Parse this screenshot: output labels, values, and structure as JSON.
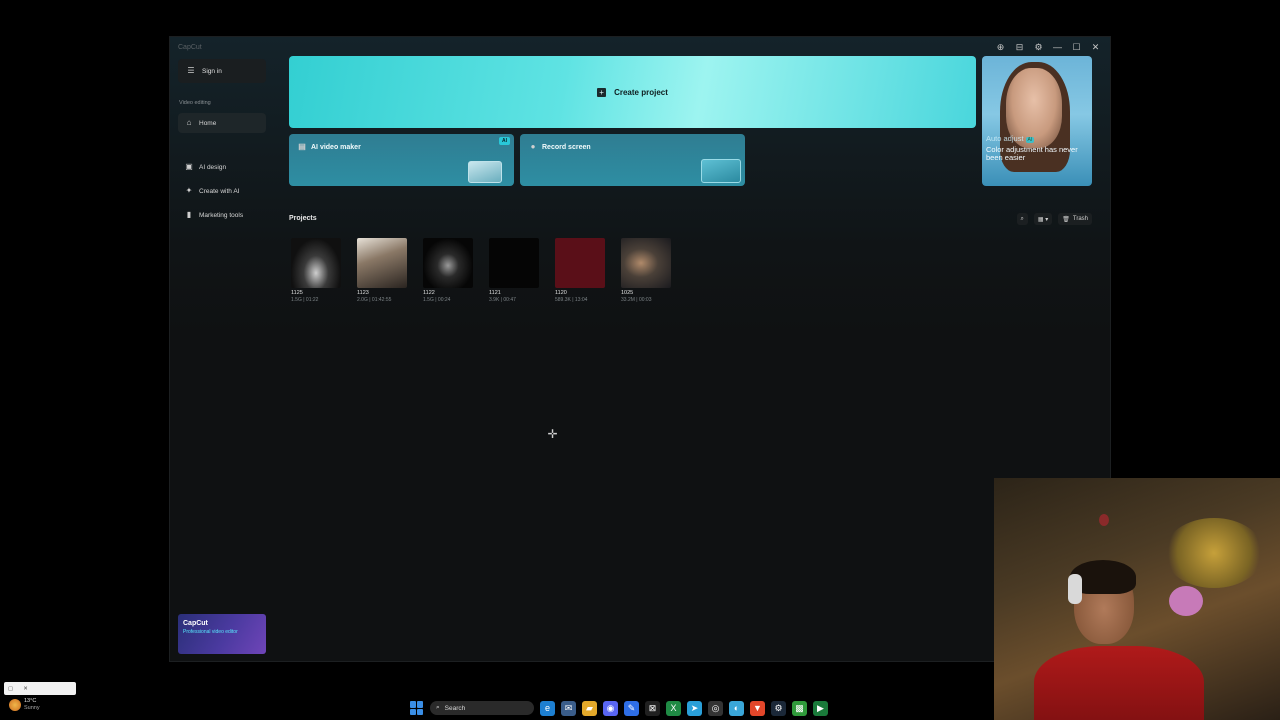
{
  "window": {
    "title": "CapCut",
    "controls": [
      "⊕",
      "⊟",
      "⚙",
      "—",
      "☐",
      "✕"
    ]
  },
  "sidebar": {
    "sign_in": "Sign in",
    "section_label": "Video editing",
    "items": [
      {
        "label": "Home",
        "icon": "home-icon",
        "active": true
      },
      {
        "label": "AI design",
        "icon": "image-icon",
        "active": false
      },
      {
        "label": "Create with AI",
        "icon": "sparkle-icon",
        "active": false
      },
      {
        "label": "Marketing tools",
        "icon": "bookmark-icon",
        "active": false
      }
    ],
    "promo": {
      "title": "CapCut",
      "subtitle": "Professional video editor"
    }
  },
  "main": {
    "create_project": "Create project",
    "ai_video_maker": {
      "label": "AI video maker",
      "badge": "AI"
    },
    "record_screen": {
      "label": "Record screen"
    },
    "ad": {
      "line1": "Auto adjust",
      "badge": "AI",
      "line2": "Color adjustment has never been easier"
    }
  },
  "projects": {
    "title": "Projects",
    "trash_label": "Trash",
    "items": [
      {
        "name": "1125",
        "meta": "1.5G | 01:22"
      },
      {
        "name": "1123",
        "meta": "2.0G | 01:42:55"
      },
      {
        "name": "1122",
        "meta": "1.5G | 00:24"
      },
      {
        "name": "1121",
        "meta": "3.9K | 00:47"
      },
      {
        "name": "1120",
        "meta": "589.3K | 13:04"
      },
      {
        "name": "1025",
        "meta": "33.2M | 00:03"
      }
    ]
  },
  "taskbar": {
    "weather_temp": "13°C",
    "weather_desc": "Sunny",
    "search_placeholder": "Search"
  }
}
